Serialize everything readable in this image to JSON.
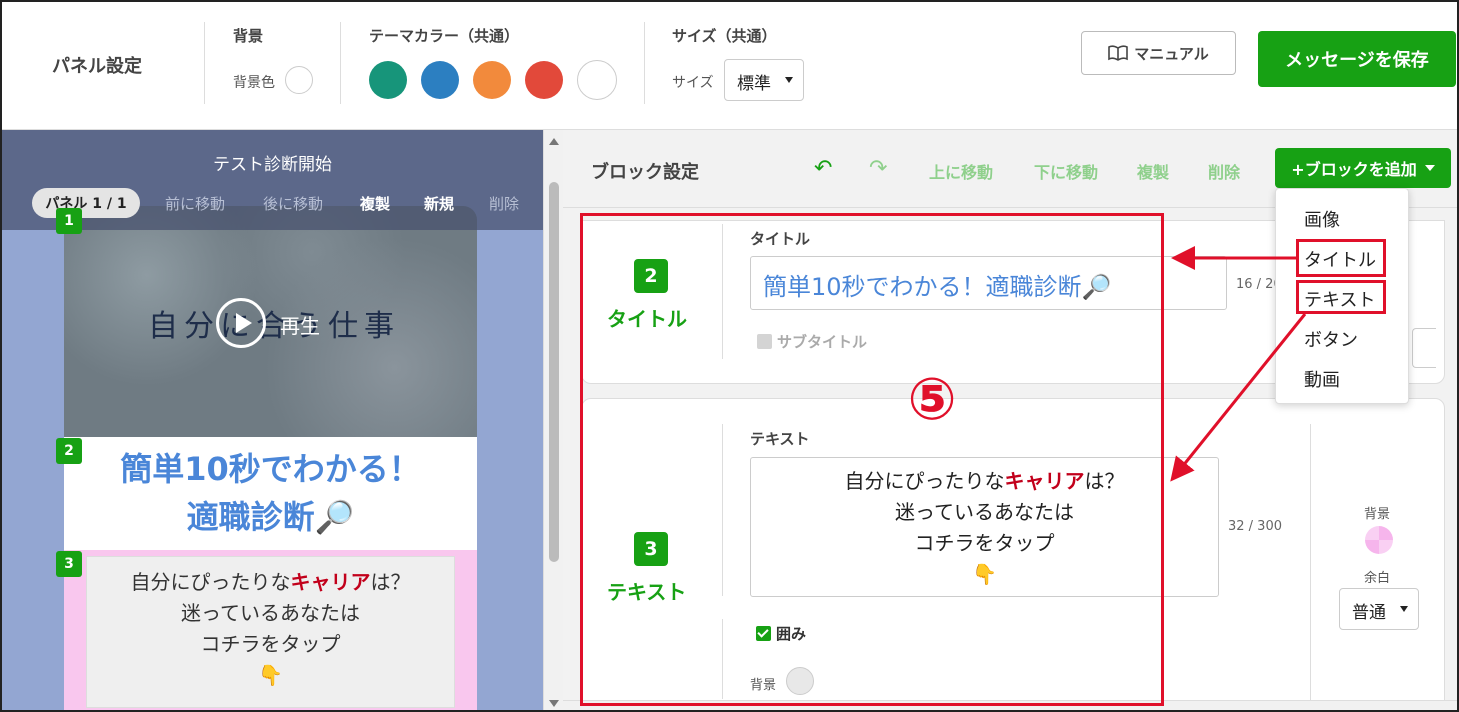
{
  "topbar": {
    "panel_settings": "パネル設定",
    "background_section": "背景",
    "background_color_label": "背景色",
    "theme_section": "テーマカラー（共通）",
    "theme_colors": [
      "#17957a",
      "#2c7fc1",
      "#f28a3c",
      "#e2493a",
      "#ffffff"
    ],
    "size_section": "サイズ（共通）",
    "size_label": "サイズ",
    "size_value": "標準",
    "manual_button": "マニュアル",
    "save_button": "メッセージを保存"
  },
  "preview": {
    "title": "テスト診断開始",
    "panel_pill": "パネル 1 / 1",
    "actions": {
      "move_prev": "前に移動",
      "move_next": "後に移動",
      "duplicate": "複製",
      "new": "新規",
      "delete": "削除"
    },
    "block_numbers": [
      "1",
      "2",
      "3"
    ],
    "video_handwriting": "自分に合う仕事",
    "play_label": "再生",
    "title_line1": "簡単10秒でわかる！",
    "title_line2": "適職診断🔎",
    "text_line1_prefix": "自分にぴったりな",
    "text_line1_highlight": "キャリア",
    "text_line1_suffix": "は？",
    "text_line2": "迷っているあなたは",
    "text_line3": "コチラをタップ",
    "text_line4": "👇"
  },
  "block_settings": {
    "title": "ブロック設定",
    "undo_icon": "↶",
    "redo_icon": "↷",
    "move_up": "上に移動",
    "move_down": "下に移動",
    "duplicate": "複製",
    "delete": "削除",
    "add_block": "+ブロックを追加"
  },
  "title_block": {
    "number": "2",
    "type": "タイトル",
    "field_label": "タイトル",
    "value": "簡単10秒でわかる！適職診断🔎",
    "counter": "16 / 20",
    "subtitle_checkbox": "サブタイトル"
  },
  "text_block": {
    "number": "3",
    "type": "テキスト",
    "field_label": "テキスト",
    "line1_prefix": "自分にぴったりな",
    "line1_highlight": "キャリア",
    "line1_suffix": "は？",
    "line2": "迷っているあなたは",
    "line3": "コチラをタップ",
    "line4": "👇",
    "counter": "32 / 300",
    "enclose_checkbox": "囲み",
    "bg_label": "背景",
    "right_bg_label": "背景",
    "margin_label": "余白",
    "margin_value": "普通"
  },
  "dropdown": {
    "items": [
      "画像",
      "タイトル",
      "テキスト",
      "ボタン",
      "動画"
    ]
  },
  "annotation": {
    "step_number": "⑤"
  }
}
